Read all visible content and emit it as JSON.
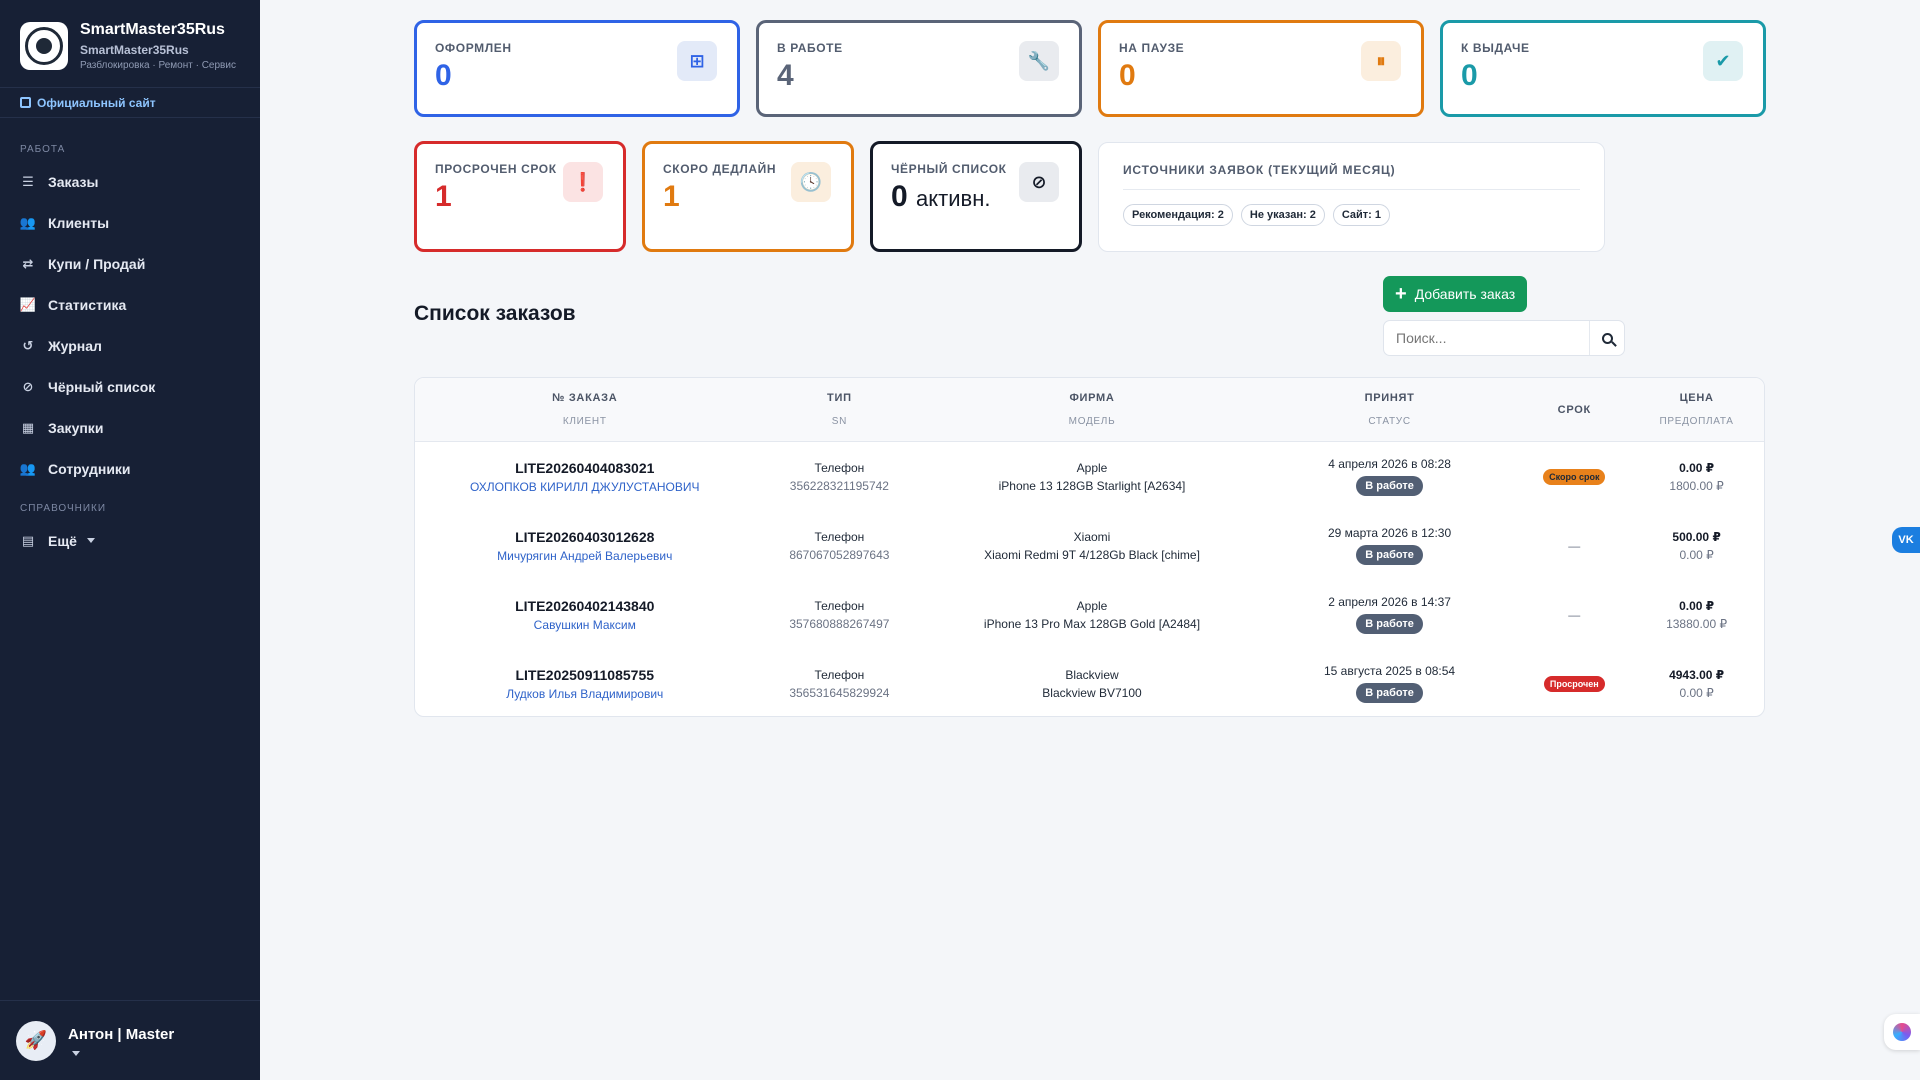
{
  "sidebar": {
    "brand_title": "SmartMaster35Rus",
    "brand_sub": "SmartMaster35Rus",
    "brand_tag": "Разблокировка · Ремонт · Сервис",
    "official_link": "Официальный сайт",
    "section_work": "РАБОТА",
    "section_ref": "СПРАВОЧНИКИ",
    "items": [
      {
        "label": "Заказы",
        "icon": "list-icon"
      },
      {
        "label": "Клиенты",
        "icon": "users-icon"
      },
      {
        "label": "Купи / Продай",
        "icon": "exchange-icon"
      },
      {
        "label": "Статистика",
        "icon": "chart-icon"
      },
      {
        "label": "Журнал",
        "icon": "history-icon"
      },
      {
        "label": "Чёрный список",
        "icon": "user-slash-icon"
      },
      {
        "label": "Закупки",
        "icon": "dolly-icon"
      },
      {
        "label": "Сотрудники",
        "icon": "staff-icon"
      }
    ],
    "more_label": "Ещё",
    "user_name": "Антон | Master"
  },
  "stats": {
    "issued": {
      "label": "ОФОРМЛЕН",
      "value": "0",
      "color": "#2f63e6"
    },
    "in_work": {
      "label": "В РАБОТЕ",
      "value": "4",
      "color": "#5a6478"
    },
    "paused": {
      "label": "НА ПАУЗЕ",
      "value": "0",
      "color": "#e07a10"
    },
    "ready": {
      "label": "К ВЫДАЧЕ",
      "value": "0",
      "color": "#1a9aa8"
    },
    "overdue": {
      "label": "ПРОСРОЧЕН СРОК",
      "value": "1",
      "color": "#d62b2b"
    },
    "deadline": {
      "label": "СКОРО ДЕДЛАЙН",
      "value": "1",
      "color": "#e07a10"
    },
    "blacklist": {
      "label": "ЧЁРНЫЙ СПИСОК",
      "value": "0",
      "suffix": "активн.",
      "color": "#141a27"
    }
  },
  "sources": {
    "title": "ИСТОЧНИКИ ЗАЯВОК (ТЕКУЩИЙ МЕСЯЦ)",
    "chips": [
      "Рекомендация: 2",
      "Не указан: 2",
      "Сайт: 1"
    ]
  },
  "orders": {
    "title": "Список заказов",
    "add_label": "Добавить заказ",
    "search_placeholder": "Поиск...",
    "headers": {
      "order_no": "№ ЗАКАЗА",
      "client": "КЛИЕНТ",
      "type": "ТИП",
      "sn": "SN",
      "brand": "ФИРМА",
      "model": "МОДЕЛЬ",
      "accepted": "ПРИНЯТ",
      "status": "СТАТУС",
      "term": "СРОК",
      "price": "ЦЕНА",
      "prepay": "ПРЕДОПЛАТА"
    },
    "rows": [
      {
        "order_no": "LITE20260404083021",
        "client": "ОХЛОПКОВ КИРИЛЛ ДЖУЛУСТАНОВИЧ",
        "type": "Телефон",
        "sn": "356228321195742",
        "brand": "Apple",
        "model": "iPhone 13 128GB Starlight [A2634]",
        "accepted": "4 апреля 2026 в 08:28",
        "status": "В работе",
        "term": "Скоро срок",
        "price": "0.00 ₽",
        "prepay": "1800.00 ₽"
      },
      {
        "order_no": "LITE20260403012628",
        "client": "Мичурягин Андрей Валерьевич",
        "type": "Телефон",
        "sn": "867067052897643",
        "brand": "Xiaomi",
        "model": "Xiaomi Redmi 9T 4/128Gb Black [chime]",
        "accepted": "29 марта 2026 в 12:30",
        "status": "В работе",
        "term": "—",
        "price": "500.00 ₽",
        "prepay": "0.00 ₽"
      },
      {
        "order_no": "LITE20260402143840",
        "client": "Савушкин Максим",
        "type": "Телефон",
        "sn": "357680888267497",
        "brand": "Apple",
        "model": "iPhone 13 Pro Max 128GB Gold [A2484]",
        "accepted": "2 апреля 2026 в 14:37",
        "status": "В работе",
        "term": "—",
        "price": "0.00 ₽",
        "prepay": "13880.00 ₽"
      },
      {
        "order_no": "LITE20250911085755",
        "client": "Лудков Илья Владимирович",
        "type": "Телефон",
        "sn": "356531645829924",
        "brand": "Blackview",
        "model": "Blackview BV7100",
        "accepted": "15 августа 2025 в 08:54",
        "status": "В работе",
        "term": "Просрочен",
        "price": "4943.00 ₽",
        "prepay": "0.00 ₽"
      }
    ]
  },
  "widgets": {
    "vk_label": "VK"
  }
}
